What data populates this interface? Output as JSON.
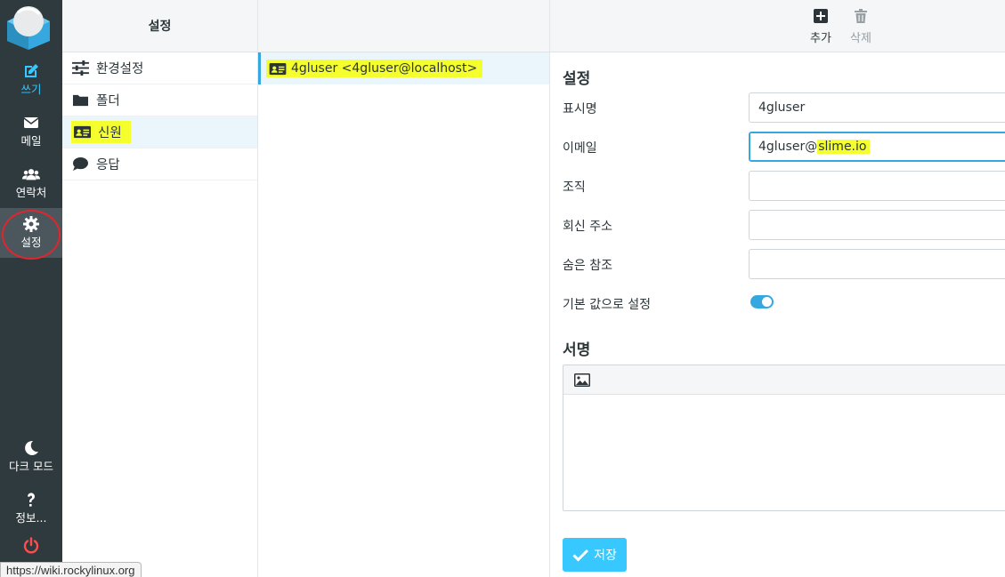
{
  "rail": {
    "compose": "쓰기",
    "mail": "메일",
    "contacts": "연락처",
    "settings": "설정",
    "dark_mode": "다크 모드",
    "about": "정보..."
  },
  "settings_nav": {
    "title": "설정",
    "items": [
      {
        "label": "환경설정",
        "icon": "sliders-icon"
      },
      {
        "label": "폴더",
        "icon": "folder-icon"
      },
      {
        "label": "신원",
        "icon": "id-card-icon"
      },
      {
        "label": "응답",
        "icon": "comment-icon"
      }
    ]
  },
  "identities": {
    "items": [
      {
        "label": "4gluser <4gluser@localhost>"
      }
    ]
  },
  "toolbar": {
    "add": "추가",
    "delete": "삭제"
  },
  "form": {
    "section_settings": "설정",
    "display_name_label": "표시명",
    "display_name_value": "4gluser",
    "email_label": "이메일",
    "email_value_prefix": "4gluser@",
    "email_value_domain": "slime.io",
    "organization_label": "조직",
    "organization_value": "",
    "reply_to_label": "회신 주소",
    "reply_to_value": "",
    "bcc_label": "숨은 참조",
    "bcc_value": "",
    "default_label": "기본 값으로 설정",
    "default_on": true,
    "section_signature": "서명",
    "save": "저장"
  },
  "status_url": "https://wiki.rockylinux.org",
  "colors": {
    "rail_bg": "#2f3a3f",
    "accent": "#37c8ff",
    "highlight": "#f6ff2e",
    "power": "#ff4d4d"
  }
}
